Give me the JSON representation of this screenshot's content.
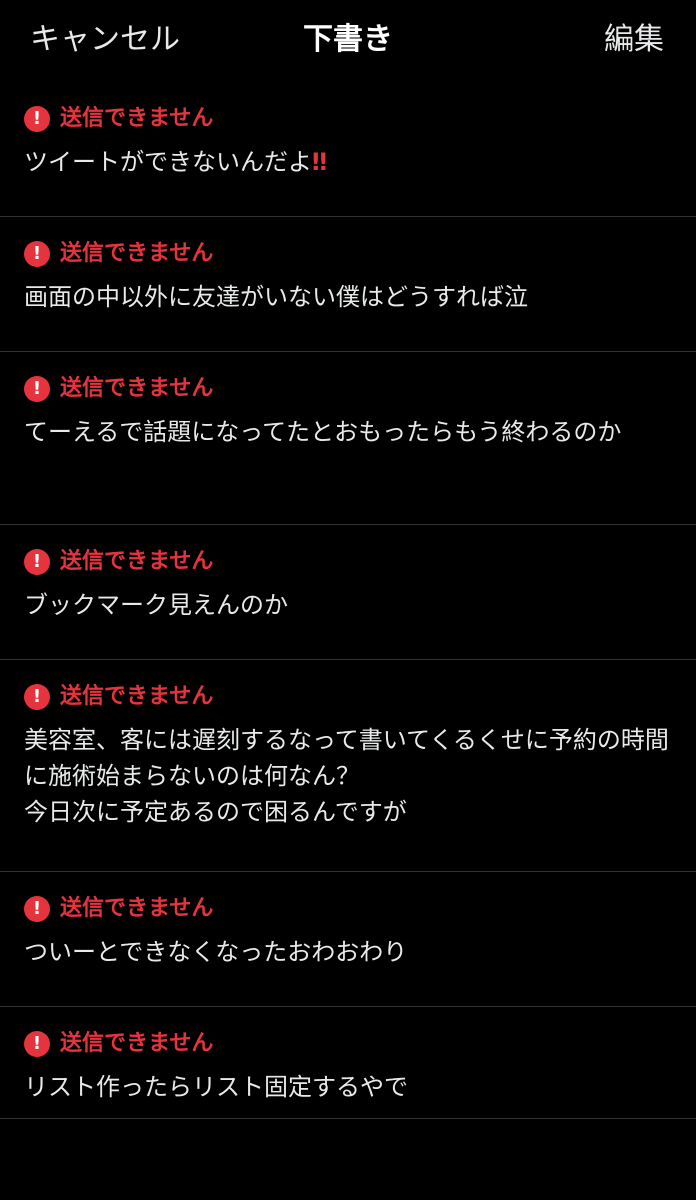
{
  "header": {
    "cancel_label": "キャンセル",
    "title": "下書き",
    "edit_label": "編集"
  },
  "error_icon": "exclamation-circle-icon",
  "accent_color": "#e5343d",
  "drafts": [
    {
      "status": "送信できません",
      "text": "ツイートができないんだよ",
      "emoji": "‼"
    },
    {
      "status": "送信できません",
      "text": "画面の中以外に友達がいない僕はどうすれば泣"
    },
    {
      "status": "送信できません",
      "text": "てーえるで話題になってたとおもったらもう終わるのか"
    },
    {
      "status": "送信できません",
      "text": "ブックマーク見えんのか"
    },
    {
      "status": "送信できません",
      "text": "美容室、客には遅刻するなって書いてくるくせに予約の時間に施術始まらないのは何なん？\n今日次に予定あるので困るんですが"
    },
    {
      "status": "送信できません",
      "text": "ついーとできなくなったおわおわり"
    },
    {
      "status": "送信できません",
      "text": "リスト作ったらリスト固定するやで"
    }
  ]
}
